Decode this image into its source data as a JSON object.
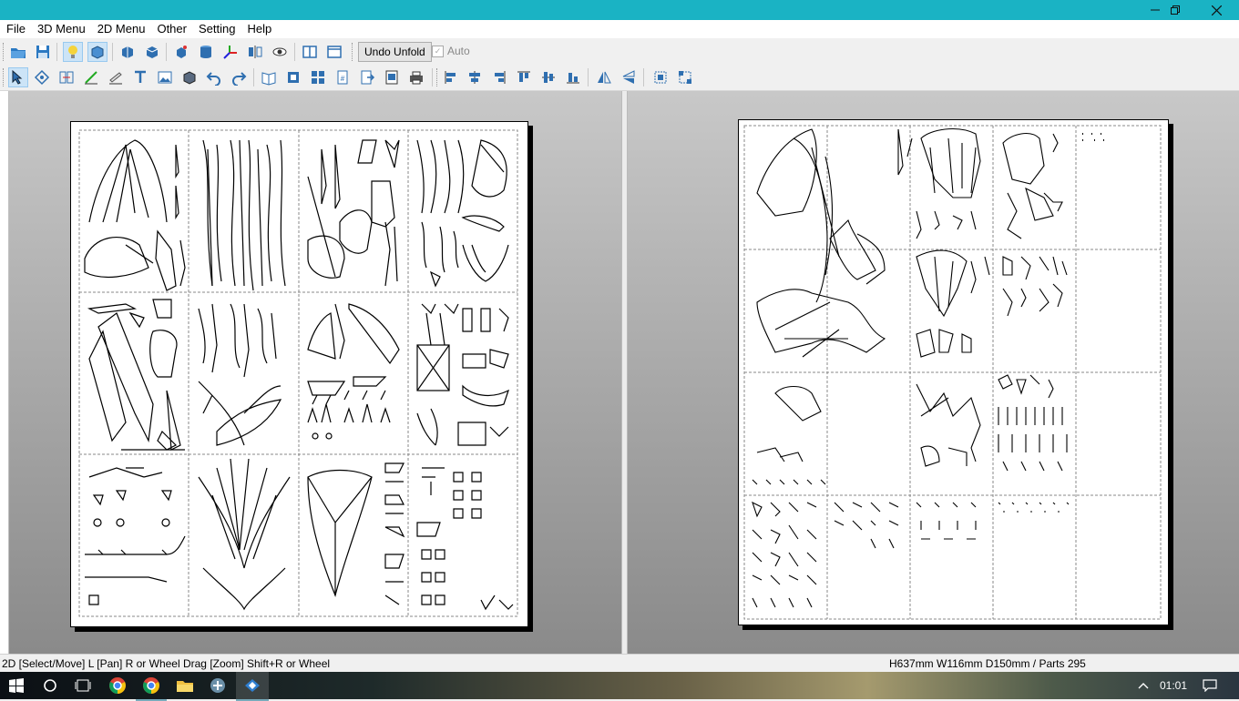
{
  "window": {
    "minimize_icon": "minimize-icon",
    "restore_icon": "restore-icon",
    "close_icon": "close-icon"
  },
  "menu": [
    "File",
    "3D Menu",
    "2D Menu",
    "Other",
    "Setting",
    "Help"
  ],
  "toolbar1": {
    "undo_unfold_label": "Undo Unfold",
    "auto_label": "Auto",
    "auto_checked": true,
    "icons": [
      "open-icon",
      "save-icon",
      "light-bulb-icon",
      "texture-icon",
      "rotate-3d-icon",
      "rotate-3d-alt-icon",
      "cube-face-icon",
      "cylinder-icon",
      "axis-icon",
      "mirror-icon",
      "eye-icon",
      "split-view-icon",
      "single-view-icon"
    ]
  },
  "toolbar2": {
    "icons": [
      "select-move-icon",
      "rotate-part-icon",
      "join-edges-icon",
      "line-icon",
      "fold-line-icon",
      "text-icon",
      "image-icon",
      "3d-box-icon",
      "undo-icon",
      "redo-icon",
      "book-icon",
      "fit-page-icon",
      "arrange-icon",
      "page-number-icon",
      "export-icon",
      "screenshot-icon",
      "print-icon",
      "align-left-icon",
      "align-center-icon",
      "align-right-icon",
      "align-top-icon",
      "align-middle-icon",
      "align-bottom-icon",
      "flip-h-icon",
      "flip-v-icon",
      "group-icon",
      "ungroup-icon"
    ]
  },
  "status": {
    "hint": "2D [Select/Move] L [Pan] R or Wheel Drag [Zoom] Shift+R or Wheel",
    "info": "H637mm W116mm D150mm / Parts 295"
  },
  "taskbar": {
    "clock": "01:01",
    "apps": [
      "windows-start-icon",
      "cortana-icon",
      "task-view-icon",
      "chrome-icon",
      "chrome-icon",
      "file-explorer-icon",
      "app-icon",
      "pepakura-icon"
    ]
  }
}
